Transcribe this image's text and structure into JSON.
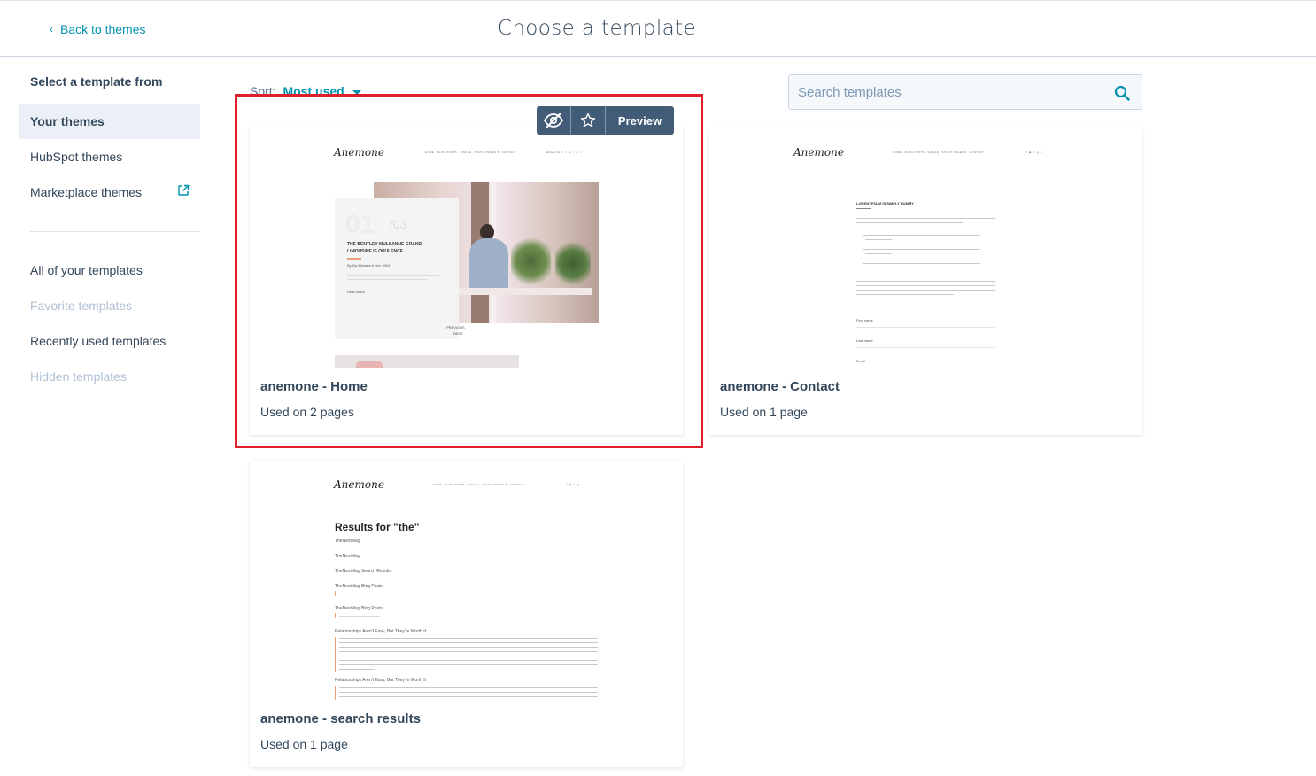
{
  "header": {
    "back_label": "Back to themes",
    "title": "Choose a template"
  },
  "sidebar": {
    "heading": "Select a template from",
    "sources": [
      {
        "label": "Your themes",
        "active": true
      },
      {
        "label": "HubSpot themes"
      },
      {
        "label": "Marketplace themes",
        "icon": "external-link-icon"
      }
    ],
    "filters": [
      {
        "label": "All of your templates"
      },
      {
        "label": "Favorite templates",
        "disabled": true
      },
      {
        "label": "Recently used templates"
      },
      {
        "label": "Hidden templates",
        "disabled": true
      }
    ]
  },
  "toolbar": {
    "sort_label": "Sort:",
    "sort_value": "Most used",
    "search_placeholder": "Search templates"
  },
  "hover_actions": {
    "hide_icon": "eye-slash-icon",
    "favorite_icon": "star-icon",
    "preview_label": "Preview"
  },
  "templates": [
    {
      "name": "anemone - Home",
      "usage": "Used on 2 pages"
    },
    {
      "name": "anemone - Contact",
      "usage": "Used on 1 page"
    },
    {
      "name": "anemone - search results",
      "usage": "Used on 1 page"
    }
  ],
  "previews": {
    "logo": "Anemone",
    "home": {
      "slide_number": "01",
      "slide_total": "/03",
      "headline_1": "THE BENTLEY MULSANNE GRAND",
      "headline_2": "LIMOUSINE IS OPULENCE",
      "byline": "By Zia Mustafa     6 Nov 2019",
      "read_more": "Read More  →",
      "prev": "PREVIOUS",
      "next": "NEXT"
    },
    "contact": {
      "heading": "LOREM IPSUM IS SIMPLY DUMMY",
      "field_1": "First name",
      "field_2": "Last name",
      "field_3": "Email"
    },
    "search": {
      "heading": "Results for \"the\"",
      "r1": "TheNextMag",
      "r2": "TheNextMag",
      "r3": "TheNextMag Search Results",
      "r4": "TheNextMag Blog Posts",
      "r5": "TheNextMag Blog Posts",
      "r6": "Relationships Aren't Easy, But They're Worth It",
      "r7": "Relationships Aren't Easy, But They're Worth It"
    }
  },
  "colors": {
    "accent": "#0091ae",
    "text": "#33475b",
    "highlight": "#e01f2b",
    "hover_bar": "#425b76"
  }
}
